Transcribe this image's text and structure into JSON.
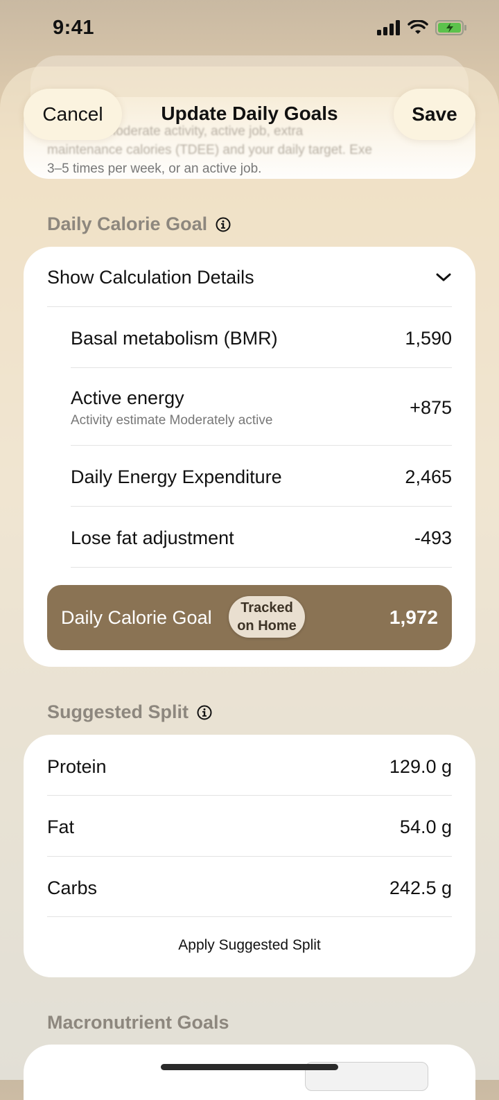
{
  "status_bar": {
    "time": "9:41"
  },
  "intro": {
    "line1": "Exercise, moderate activity, active job, extra",
    "line2": "maintenance calories (TDEE) and your daily target. Exe",
    "line3": "3–5 times per week, or an active job."
  },
  "nav": {
    "cancel_label": "Cancel",
    "title": "Update Daily Goals",
    "save_label": "Save"
  },
  "calorie_section": {
    "header": "Daily Calorie Goal",
    "toggle_label": "Show Calculation Details",
    "rows": [
      {
        "label": "Basal metabolism (BMR)",
        "value": "1,590"
      },
      {
        "label": "Active energy",
        "sub": "Activity estimate Moderately active",
        "value": "+875"
      },
      {
        "label": "Daily Energy Expenditure",
        "value": "2,465"
      },
      {
        "label": "Lose fat adjustment",
        "value": "-493"
      }
    ],
    "goal": {
      "label": "Daily Calorie Goal",
      "badge_line1": "Tracked",
      "badge_line2": "on Home",
      "value": "1,972"
    }
  },
  "split_section": {
    "header": "Suggested Split",
    "rows": [
      {
        "label": "Protein",
        "value": "129.0 g"
      },
      {
        "label": "Fat",
        "value": "54.0 g"
      },
      {
        "label": "Carbs",
        "value": "242.5 g"
      }
    ],
    "apply_label": "Apply Suggested Split"
  },
  "macro_section": {
    "header": "Macronutrient Goals"
  },
  "colors": {
    "goal_bar": "#8a7354",
    "section_header": "#8d877e",
    "pill_bg": "#fbf3df"
  }
}
